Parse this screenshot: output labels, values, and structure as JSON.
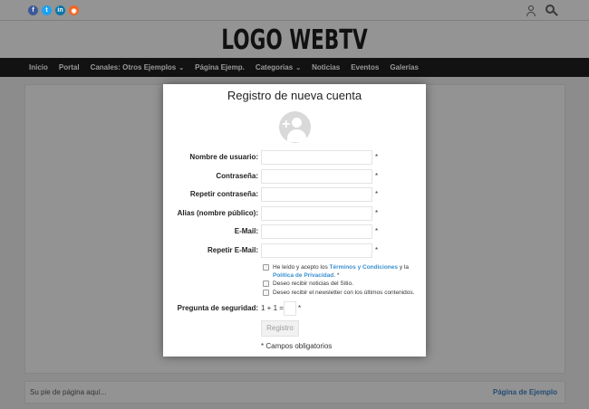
{
  "header": {
    "social_icons": [
      "facebook-icon",
      "twitter-icon",
      "linkedin-icon",
      "rss-icon"
    ],
    "social_glyphs": [
      "f",
      "t",
      "in",
      "◉"
    ],
    "social_colors": [
      "#3b5998",
      "#1da1f2",
      "#0e76a8",
      "#f26522"
    ],
    "logo": "LOGO WEBTV"
  },
  "nav": {
    "items": [
      {
        "label": "Inicio",
        "has_dropdown": false
      },
      {
        "label": "Portal",
        "has_dropdown": false
      },
      {
        "label": "Canales: Otros Ejemplos",
        "has_dropdown": true
      },
      {
        "label": "Página Ejemp.",
        "has_dropdown": false
      },
      {
        "label": "Categorias",
        "has_dropdown": true
      },
      {
        "label": "Noticias",
        "has_dropdown": false
      },
      {
        "label": "Eventos",
        "has_dropdown": false
      },
      {
        "label": "Galerías",
        "has_dropdown": false
      }
    ],
    "chevron": "⌄"
  },
  "footer": {
    "text": "Su pie de página aquí...",
    "link": "Página de Ejemplo"
  },
  "modal": {
    "title": "Registro de nueva cuenta",
    "avatar_plus": "+",
    "fields": [
      {
        "label": "Nombre de usuario:",
        "value": "",
        "required": "*"
      },
      {
        "label": "Contraseña:",
        "value": "",
        "required": "*"
      },
      {
        "label": "Repetir contraseña:",
        "value": "",
        "required": "*"
      },
      {
        "label": "Alias (nombre público):",
        "value": "",
        "required": "*"
      },
      {
        "label": "E-Mail:",
        "value": "",
        "required": "*"
      },
      {
        "label": "Repetir E-Mail:",
        "value": "",
        "required": "*"
      }
    ],
    "terms": {
      "prefix": "He leído y acepto los ",
      "terms_link": "Términos y Condiciones",
      "middle": " y la ",
      "privacy_link": "Política de Privacidad",
      "suffix": ". *"
    },
    "news_checkbox": "Deseo recibir noticias del Sitio.",
    "newsletter_checkbox": "Deseo recibir el newsletter con los últimos contenidos.",
    "security": {
      "label": "Pregunta de seguridad:",
      "question": "1 + 1 =",
      "value": "",
      "required": "*"
    },
    "submit_label": "Registro",
    "required_note": "* Campos obligatorios"
  }
}
